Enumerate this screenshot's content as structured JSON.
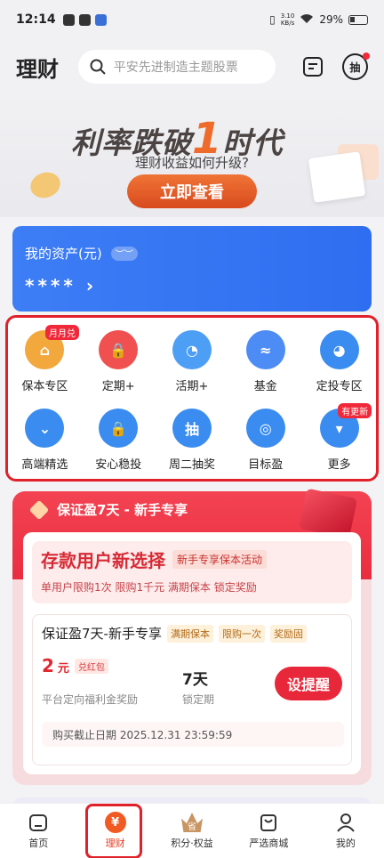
{
  "status_bar": {
    "time": "12:14",
    "net_speed_value": "3.10",
    "net_speed_unit": "KB/s",
    "battery": "29%"
  },
  "header": {
    "title": "理财",
    "search_placeholder": "平安先进制造主题股票",
    "lottery_label": "抽"
  },
  "banner": {
    "headline_part1": "利率跌破",
    "headline_big": "1",
    "headline_part2": "时代",
    "subtitle": "理财收益如何升级?",
    "cta": "立即查看"
  },
  "assets": {
    "label": "我的资产(元)",
    "value": "****",
    "arrow": "›"
  },
  "grid": {
    "items": [
      {
        "label": "保本专区",
        "icon": "bank-icon",
        "color": "#f2a83d",
        "glyph": "⌂",
        "badge": "月月兑"
      },
      {
        "label": "定期+",
        "icon": "lock-icon",
        "color": "#f05050",
        "glyph": "🔒",
        "badge": ""
      },
      {
        "label": "活期+",
        "icon": "clock-icon",
        "color": "#4d9ef5",
        "glyph": "◔",
        "badge": ""
      },
      {
        "label": "基金",
        "icon": "chart-icon",
        "color": "#4d8cf5",
        "glyph": "≈",
        "badge": ""
      },
      {
        "label": "定投专区",
        "icon": "timer-icon",
        "color": "#3a8cf0",
        "glyph": "◕",
        "badge": ""
      },
      {
        "label": "高端精选",
        "icon": "chevron-down-icon",
        "color": "#3a8cf0",
        "glyph": "⌄",
        "badge": ""
      },
      {
        "label": "安心稳投",
        "icon": "safe-lock-icon",
        "color": "#3a8cf0",
        "glyph": "🔒",
        "badge": ""
      },
      {
        "label": "周二抽奖",
        "icon": "lottery-icon",
        "color": "#3a8cf0",
        "glyph": "抽",
        "badge": ""
      },
      {
        "label": "目标盈",
        "icon": "target-icon",
        "color": "#3a8cf0",
        "glyph": "◎",
        "badge": ""
      },
      {
        "label": "更多",
        "icon": "more-icon",
        "color": "#3a8cf0",
        "glyph": "▾",
        "badge": "有更新"
      }
    ]
  },
  "promo": {
    "header": "保证盈7天 - 新手专享",
    "highlight_title": "存款用户新选择",
    "highlight_tag": "新手专享保本活动",
    "highlight_sub": "单用户限购1次   限购1千元   满期保本   锁定奖励",
    "product": {
      "name": "保证盈7天-新手专享",
      "tags": [
        "满期保本",
        "限购一次",
        "奖励固"
      ],
      "rate_value": "2",
      "rate_unit": "元",
      "coupon": "兑红包",
      "period": "7天",
      "rate_label": "平台定向福利金奖励",
      "period_label": "锁定期",
      "cta": "设提醒",
      "deadline": "购买截止日期 2025.12.31 23:59:59"
    }
  },
  "bottom_nav": {
    "items": [
      {
        "label": "首页",
        "icon": "home-icon"
      },
      {
        "label": "理财",
        "icon": "wealth-icon",
        "glyph": "¥"
      },
      {
        "label": "积分·权益",
        "icon": "crown-icon",
        "glyph": "省"
      },
      {
        "label": "严选商城",
        "icon": "shopping-bag-icon"
      },
      {
        "label": "我的",
        "icon": "user-icon"
      }
    ],
    "active_index": 1
  },
  "colors": {
    "accent_red": "#e8283a",
    "asset_blue": "#3d7df5",
    "active_nav": "#e63b1e"
  }
}
